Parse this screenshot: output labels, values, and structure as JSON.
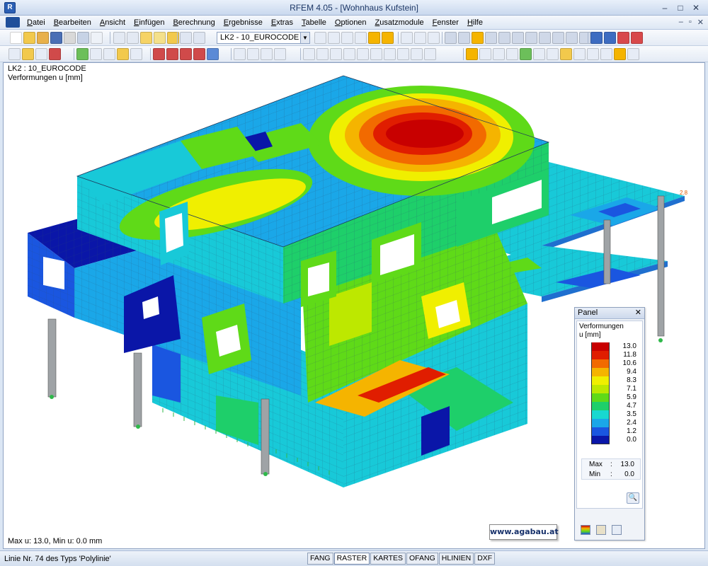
{
  "window": {
    "title": "RFEM 4.05 - [Wohnhaus Kufstein]",
    "controls": [
      "–",
      "□",
      "✕"
    ]
  },
  "menu": {
    "items": [
      "Datei",
      "Bearbeiten",
      "Ansicht",
      "Einfügen",
      "Berechnung",
      "Ergebnisse",
      "Extras",
      "Tabelle",
      "Optionen",
      "Zusatzmodule",
      "Fenster",
      "Hilfe"
    ],
    "mdi_controls": [
      "–",
      "▫",
      "✕"
    ]
  },
  "toolbar": {
    "loadcase": "LK2 - 10_EUROCODE"
  },
  "view": {
    "loadcase_label": "LK2 : 10_EUROCODE",
    "result_label": "Verformungen u [mm]",
    "footer": "Max u: 13.0, Min u: 0.0 mm",
    "watermark": "www.agabau.at",
    "node_label": "2.8"
  },
  "panel": {
    "title": "Panel",
    "close": "✕",
    "subtitle_line1": "Verformungen",
    "subtitle_line2": "u [mm]",
    "legend": [
      {
        "value": "13.0",
        "color": "#c80000"
      },
      {
        "value": "11.8",
        "color": "#e01d00"
      },
      {
        "value": "10.6",
        "color": "#f26a00"
      },
      {
        "value": "9.4",
        "color": "#f5b400"
      },
      {
        "value": "8.3",
        "color": "#f0ef00"
      },
      {
        "value": "7.1",
        "color": "#bde800"
      },
      {
        "value": "5.9",
        "color": "#5fda18"
      },
      {
        "value": "4.7",
        "color": "#1ecf6a"
      },
      {
        "value": "3.5",
        "color": "#18d8d0"
      },
      {
        "value": "2.4",
        "color": "#1aa7e8"
      },
      {
        "value": "1.2",
        "color": "#1a56e0"
      },
      {
        "value": "0.0",
        "color": "#0a16a8"
      }
    ],
    "max_label": "Max",
    "max_value": "13.0",
    "min_label": "Min",
    "min_value": "0.0",
    "zoom_icon": "🔍"
  },
  "statusbar": {
    "text": "Linie Nr. 74 des Typs 'Polylinie'",
    "toggles": [
      {
        "label": "FANG",
        "on": false
      },
      {
        "label": "RASTER",
        "on": true
      },
      {
        "label": "KARTES",
        "on": false
      },
      {
        "label": "OFANG",
        "on": false
      },
      {
        "label": "HLINIEN",
        "on": false
      },
      {
        "label": "DXF",
        "on": false
      }
    ]
  }
}
